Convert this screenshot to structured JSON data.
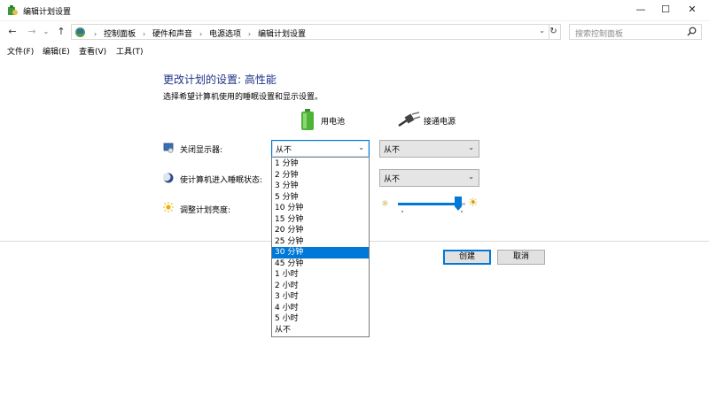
{
  "window": {
    "title": "编辑计划设置",
    "controls": {
      "minimize": "—",
      "maximize": "☐",
      "close": "✕"
    }
  },
  "nav": {
    "back": "←",
    "forward": "→",
    "recent": "⌄",
    "up": "↑",
    "breadcrumbs": [
      "控制面板",
      "硬件和声音",
      "电源选项",
      "编辑计划设置"
    ],
    "refresh": "↻",
    "search_placeholder": "搜索控制面板"
  },
  "menu": [
    "文件(F)",
    "编辑(E)",
    "查看(V)",
    "工具(T)"
  ],
  "page": {
    "title": "更改计划的设置: 高性能",
    "subtitle": "选择希望计算机使用的睡眠设置和显示设置。",
    "columns": {
      "battery": "用电池",
      "plugged": "接通电源"
    },
    "rows": {
      "display": "关闭显示器:",
      "sleep": "使计算机进入睡眠状态:",
      "brightness": "调整计划亮度:"
    },
    "values": {
      "display_battery": "从不",
      "display_plugged": "从不",
      "sleep_plugged": "从不"
    },
    "brightness_level": 0.9,
    "buttons": {
      "create": "创建",
      "cancel": "取消"
    }
  },
  "dropdown": {
    "options": [
      "1 分钟",
      "2 分钟",
      "3 分钟",
      "5 分钟",
      "10 分钟",
      "15 分钟",
      "20 分钟",
      "25 分钟",
      "30 分钟",
      "45 分钟",
      "1 小时",
      "2 小时",
      "3 小时",
      "4 小时",
      "5 小时",
      "从不"
    ],
    "highlighted": "30 分钟"
  },
  "colors": {
    "accent": "#0078d7",
    "title_blue": "#1e3287"
  }
}
